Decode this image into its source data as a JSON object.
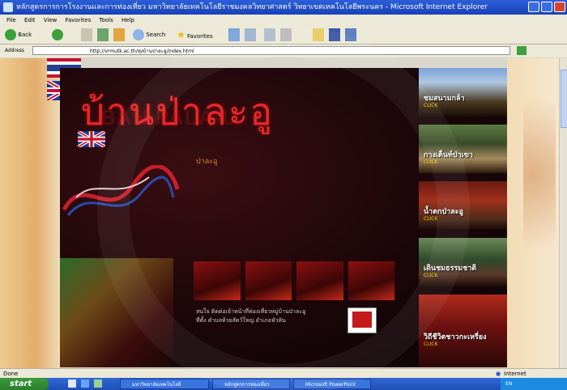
{
  "window": {
    "title": "หลักสูตรการการโรงงานและการท่องเที่ยว มหาวิทยาลัยเทคโนโลยีราชมงคลวิทยาศาสตร์ วิทยาเขตเทคโนโลยีพระนคร - Microsoft Internet Explorer"
  },
  "menu": [
    "File",
    "Edit",
    "View",
    "Favorites",
    "Tools",
    "Help"
  ],
  "toolbar": {
    "back_label": "Back",
    "search_label": "Search",
    "favorites_label": "Favorites"
  },
  "address": {
    "label": "Address",
    "url": "http://vrmutk.ac.th/ทุ่งบ้านป่าละอู/index.html"
  },
  "site": {
    "heading": "บ้านป่าละอู",
    "heading_ghost": "BAN PALA-U",
    "subnav": "ป่าละอู"
  },
  "info": {
    "line1": "สนใจ   ติดต่อเจ้าหน้าที่ท่องเที่ยวหมู่บ้านป่าละอู",
    "line2": "ที่ตั้ง    ตำบลห้วยสัตว์ใหญ่ อำเภอหัวหิน"
  },
  "side_menu": [
    {
      "label": "ชมสนามกล้า",
      "sub": "CLICK"
    },
    {
      "label": "กางเต็นท์ป่าเขา",
      "sub": "CLICK"
    },
    {
      "label": "น้ำตกป่าละอู",
      "sub": "CLICK"
    },
    {
      "label": "เดินชมธรรมชาติ",
      "sub": "CLICK"
    },
    {
      "label": "วิถีชีวิตชาวกะเหรี่ยง",
      "sub": "CLICK"
    }
  ],
  "status": {
    "left": "Done",
    "right": "Internet"
  },
  "taskbar": {
    "start": "start",
    "tasks": [
      "มหาวิทยาลัยเทคโนโลยี",
      "หลักสูตรการท่องเที่ยว",
      "Microsoft PowerPoint"
    ],
    "clock": "EN"
  },
  "colors": {
    "heading_red": "#e8262a",
    "page_bg": "#120609",
    "xp_blue": "#2b5fd9"
  }
}
